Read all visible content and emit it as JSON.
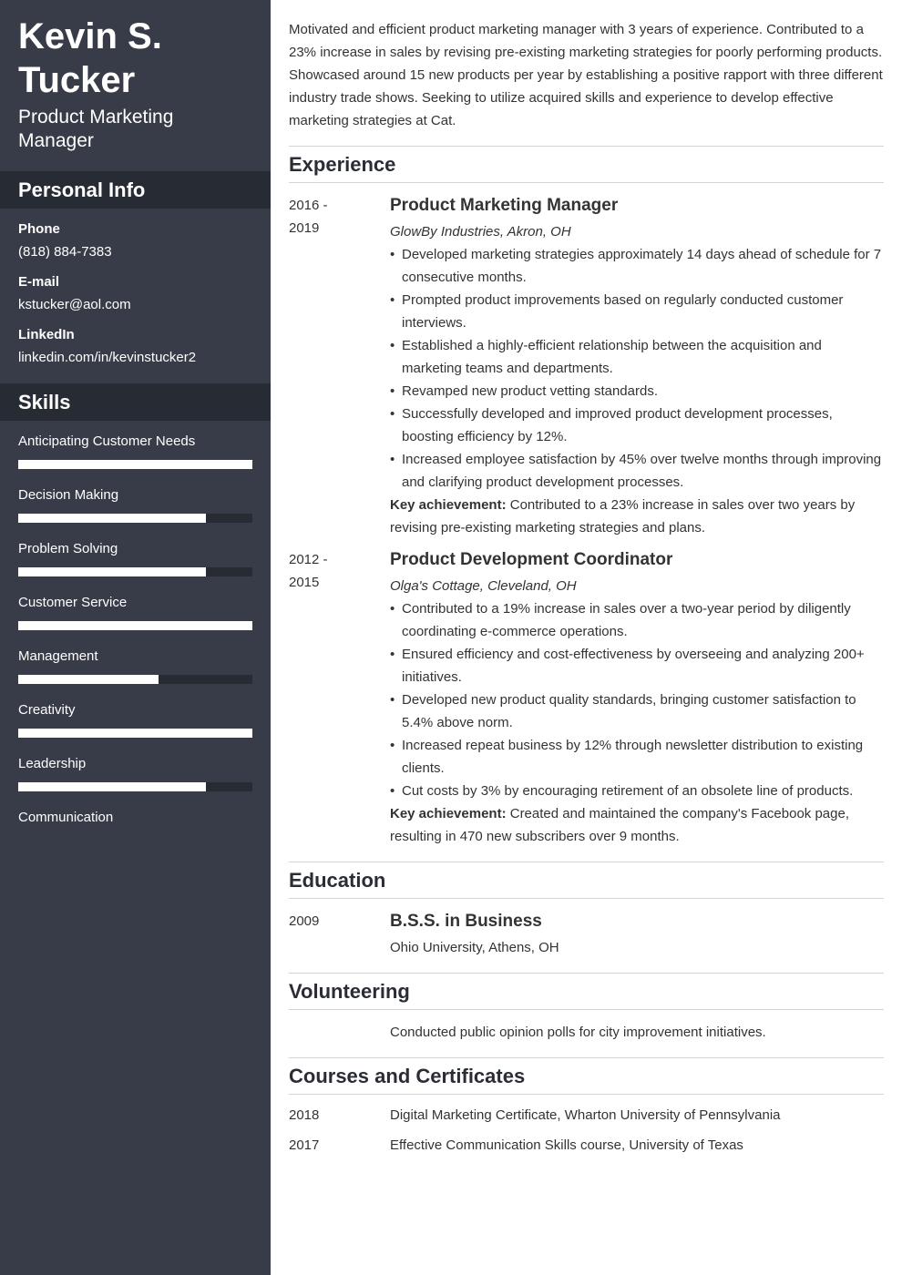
{
  "profile": {
    "name": "Kevin S. Tucker",
    "title": "Product Marketing Manager"
  },
  "personal_info": {
    "heading": "Personal Info",
    "items": [
      {
        "label": "Phone",
        "value": "(818) 884-7383"
      },
      {
        "label": "E-mail",
        "value": "kstucker@aol.com"
      },
      {
        "label": "LinkedIn",
        "value": "linkedin.com/in/kevinstucker2"
      }
    ]
  },
  "skills": {
    "heading": "Skills",
    "items": [
      {
        "name": "Anticipating Customer Needs",
        "level": 1.0
      },
      {
        "name": "Decision Making",
        "level": 0.8
      },
      {
        "name": "Problem Solving",
        "level": 0.8
      },
      {
        "name": "Customer Service",
        "level": 1.0
      },
      {
        "name": "Management",
        "level": 0.6
      },
      {
        "name": "Creativity",
        "level": 1.0
      },
      {
        "name": "Leadership",
        "level": 0.8
      },
      {
        "name": "Communication",
        "level": null
      }
    ]
  },
  "summary": "Motivated and efficient product marketing manager with 3 years of experience. Contributed to a 23% increase in sales by revising pre-existing marketing strategies for poorly performing products. Showcased around 15 new products per year by establishing a positive rapport with three different industry trade shows. Seeking to utilize acquired skills and experience to develop effective marketing strategies at Cat.",
  "experience": {
    "heading": "Experience",
    "jobs": [
      {
        "date": "2016 - 2019",
        "title": "Product Marketing Manager",
        "company": "GlowBy Industries, Akron, OH",
        "bullets": [
          "Developed marketing strategies approximately 14 days ahead of schedule for 7 consecutive months.",
          "Prompted product improvements based on regularly conducted customer interviews.",
          "Established a highly-efficient relationship between the acquisition and marketing teams and departments.",
          "Revamped new product vetting standards.",
          "Successfully developed and improved product development processes, boosting efficiency by 12%.",
          "Increased employee satisfaction by 45% over twelve months through improving and clarifying product development processes."
        ],
        "key_label": "Key achievement:",
        "key_text": " Contributed to a 23% increase in sales over two years by revising pre-existing marketing strategies and plans."
      },
      {
        "date": "2012 - 2015",
        "title": "Product Development Coordinator",
        "company": "Olga's Cottage, Cleveland, OH",
        "bullets": [
          "Contributed to a 19% increase in sales over a two-year period by diligently coordinating e-commerce operations.",
          "Ensured efficiency and cost-effectiveness by overseeing and analyzing 200+ initiatives.",
          "Developed new product quality standards, bringing customer satisfaction to 5.4% above norm.",
          "Increased repeat business by 12% through newsletter distribution to existing clients.",
          "Cut costs by 3% by encouraging retirement of an obsolete line of products."
        ],
        "key_label": "Key achievement:",
        "key_text": " Created and maintained the company's Facebook page, resulting in 470 new subscribers over 9 months."
      }
    ]
  },
  "education": {
    "heading": "Education",
    "items": [
      {
        "date": "2009",
        "degree": "B.S.S. in Business",
        "school": "Ohio University, Athens, OH"
      }
    ]
  },
  "volunteering": {
    "heading": "Volunteering",
    "text": "Conducted public opinion polls for city improvement initiatives."
  },
  "courses": {
    "heading": "Courses and Certificates",
    "items": [
      {
        "date": "2018",
        "text": "Digital Marketing Certificate, Wharton University of Pennsylvania"
      },
      {
        "date": "2017",
        "text": "Effective Communication Skills course, University of Texas"
      }
    ]
  }
}
